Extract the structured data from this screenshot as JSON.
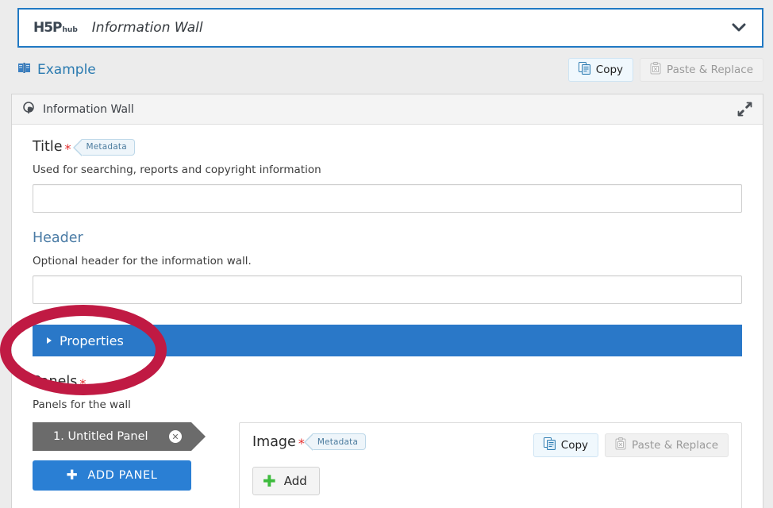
{
  "hub": {
    "logo_main": "H5P",
    "logo_sub": "hub",
    "title": "Information Wall",
    "chevron_icon": "chevron-down-icon"
  },
  "actions": {
    "example_label": "Example",
    "example_icon": "book-icon",
    "copy_label": "Copy",
    "copy_icon": "copy-icon",
    "paste_label": "Paste & Replace",
    "paste_icon": "clipboard-icon",
    "accent_blue": "#2a7ab0"
  },
  "editor": {
    "library_name": "Information Wall",
    "library_icon": "information-wall-icon",
    "fullscreen_icon": "expand-arrows-icon"
  },
  "fields": {
    "title": {
      "label": "Title",
      "required_marker": "*",
      "metadata_badge": "Metadata",
      "description": "Used for searching, reports and copyright information",
      "value": "",
      "placeholder": ""
    },
    "header": {
      "label": "Header",
      "description": "Optional header for the information wall.",
      "value": "",
      "placeholder": ""
    }
  },
  "properties": {
    "label": "Properties",
    "toggle_icon": "triangle-right-icon",
    "bar_color": "#2a78c8"
  },
  "panels": {
    "label": "Panels",
    "required_marker": "*",
    "description": "Panels for the wall",
    "tabs": [
      {
        "label": "1. Untitled Panel",
        "close_icon": "close-circle-icon"
      }
    ],
    "add_panel_label": "ADD PANEL",
    "add_panel_icon": "plus-icon",
    "panel_content": {
      "image_label": "Image",
      "required_marker": "*",
      "metadata_badge": "Metadata",
      "add_label": "Add",
      "add_icon": "green-plus-icon",
      "copy_label": "Copy",
      "copy_icon": "copy-icon",
      "paste_label": "Paste & Replace",
      "paste_icon": "clipboard-icon"
    }
  },
  "annotation": {
    "shape": "ellipse-highlight",
    "color": "#c01a43",
    "target": "Properties"
  }
}
